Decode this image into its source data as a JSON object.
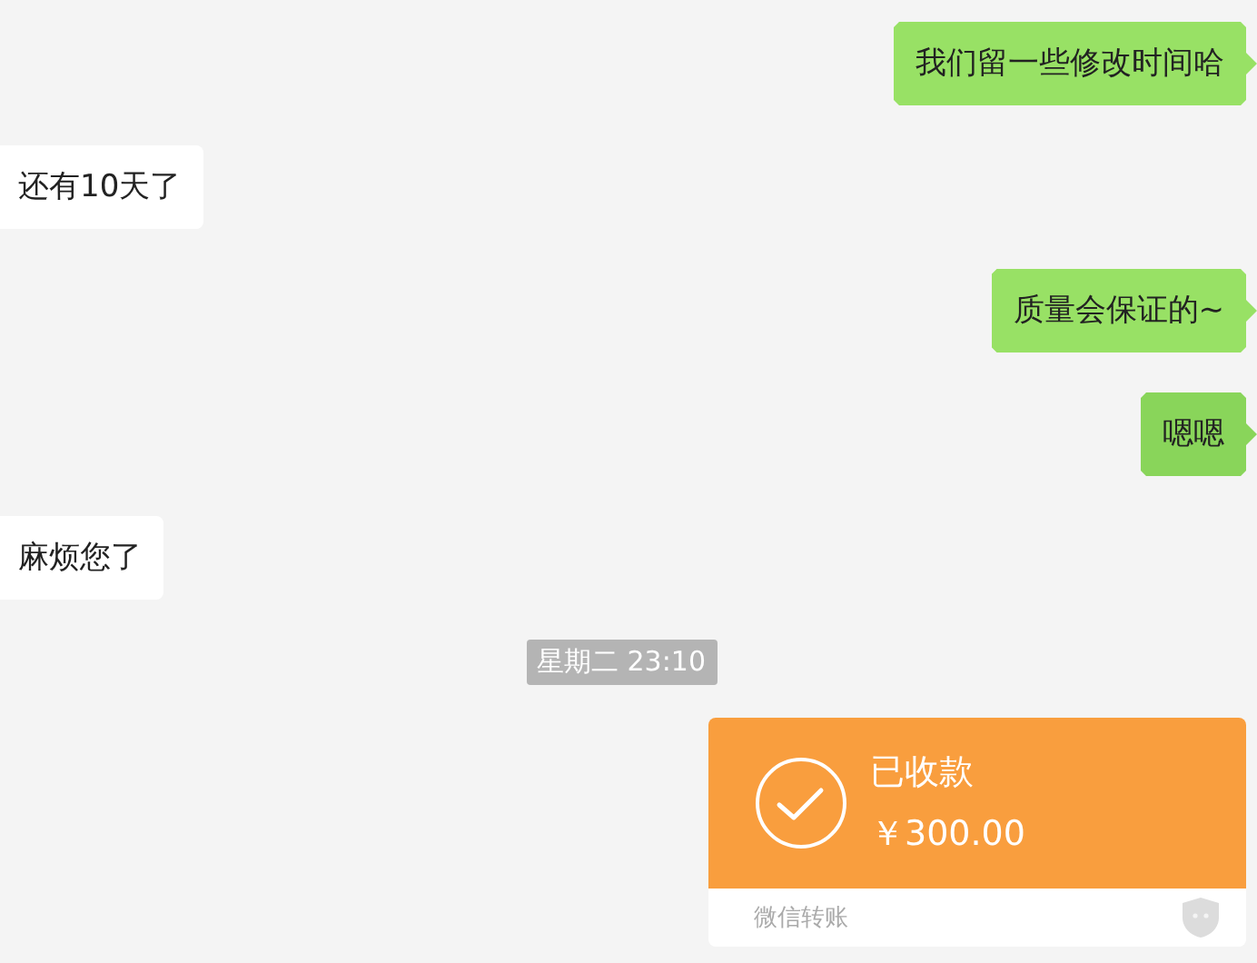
{
  "messages": [
    {
      "kind": "sent",
      "text": "我们留一些修改时间哈",
      "highlighted": false
    },
    {
      "kind": "received",
      "text": "还有10天了"
    },
    {
      "kind": "sent",
      "text": "质量会保证的~",
      "highlighted": false
    },
    {
      "kind": "sent",
      "text": "嗯嗯",
      "highlighted": true
    },
    {
      "kind": "received",
      "text": "麻烦您了"
    },
    {
      "kind": "time",
      "text": "星期二 23:10"
    },
    {
      "kind": "transfer",
      "status": "已收款",
      "amount": "￥300.00",
      "footer": "微信转账"
    }
  ]
}
